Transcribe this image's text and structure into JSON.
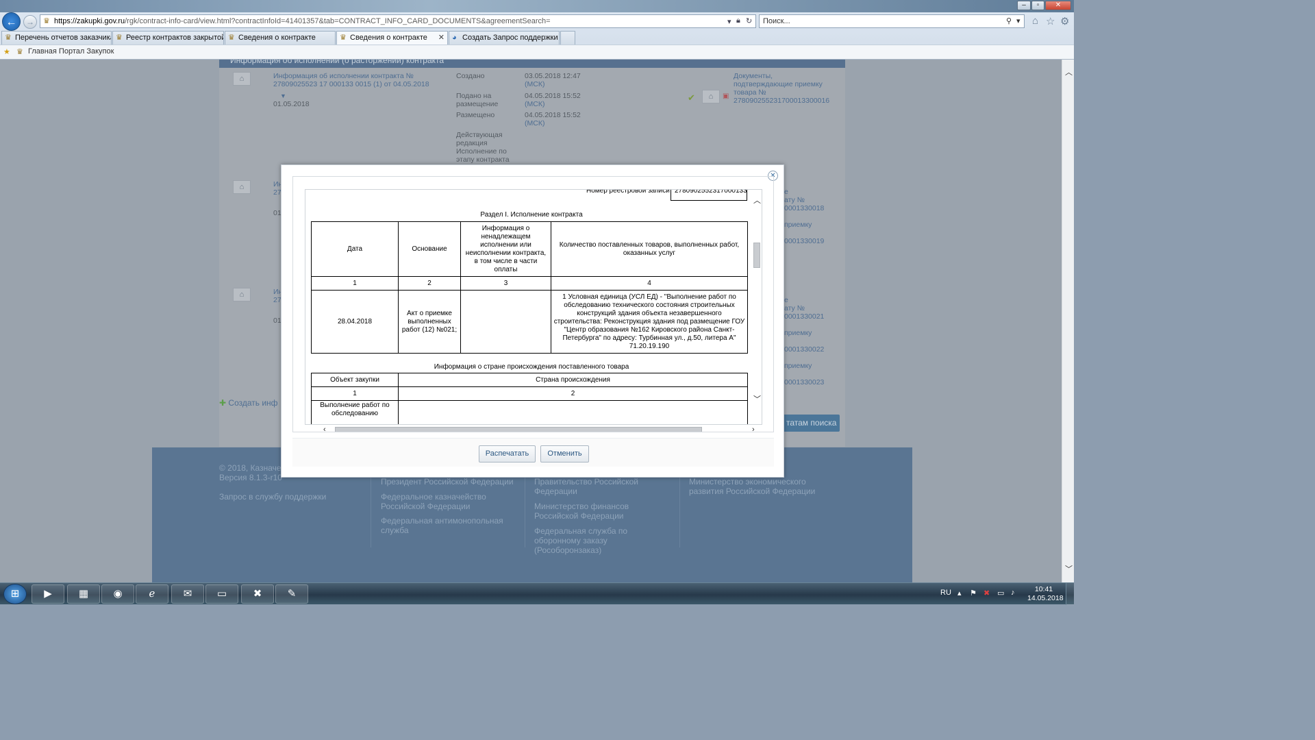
{
  "browser": {
    "url": "https://zakupki.gov.ru/rgk/contract-info-card/view.html?contractInfoId=41401357&tab=CONTRACT_INFO_CARD_DOCUMENTS&agreementSearch=",
    "url_host": "https://zakupki.gov.ru",
    "url_path": "/rgk/contract-info-card/view.html?contractInfoId=41401357&tab=CONTRACT_INFO_CARD_DOCUMENTS&agreementSearch=",
    "search_placeholder": "Поиск...",
    "tabs": [
      {
        "label": "Перечень отчетов заказчика"
      },
      {
        "label": "Реестр контрактов закрытой ..."
      },
      {
        "label": "Сведения о контракте"
      },
      {
        "label": "Сведения о контракте",
        "active": true
      },
      {
        "label": "Создать Запрос поддержки - ..."
      }
    ],
    "favorites": {
      "item": "Главная Портал Закупок"
    }
  },
  "page": {
    "panel_title": "Информация об исполнении (о расторжении) контракта",
    "row1": {
      "title": "Информация об исполнении контракта № 27809025523 17 000133 0015 (1) от 04.05.2018",
      "date": "01.05.2018",
      "created_label": "Создано",
      "created_date": "03.05.2018 12:47",
      "tz": "(МСК)",
      "submitted_label": "Подано на размещение",
      "submitted_date": "04.05.2018 15:52",
      "placed_label": "Размещено",
      "placed_date": "04.05.2018 15:52",
      "current_label": "Действующая редакция Исполнение по этапу контракта",
      "docs_link": "Документы, подтверждающие приемку товара № 278090255231700013300016"
    },
    "partial_left": [
      "Ин",
      "27",
      "01",
      "Ин",
      "27",
      "01"
    ],
    "partial_right": [
      "е",
      "ату №",
      "0001330018",
      "приемку",
      "0001330019",
      "е",
      "ату №",
      "0001330021",
      "приемку",
      "0001330022",
      "приемку",
      "0001330023"
    ],
    "create_link": "Создать инф",
    "results_button": "татам поиска",
    "footer": {
      "copyright": "© 2018, Казначе",
      "version": "Версия 8.1.3-r10",
      "support": "Запрос в службу поддержки",
      "col2": [
        "Президент Российской Федерации",
        "Федеральное казначейство Российской Федерации",
        "Федеральная антимонопольная служба"
      ],
      "col3": [
        "Правительство Российской Федерации",
        "Министерство финансов Российской Федерации",
        "Федеральная служба по оборонному заказу (Рособоронзаказ)"
      ],
      "col4": [
        "Министерство экономического развития Российской Федерации"
      ]
    }
  },
  "modal": {
    "reg_label": "Номер реестровой записи",
    "reg_value": "2780902552317000133",
    "section_title": "Раздел I. Исполнение контракта",
    "table1": {
      "headers": [
        "Дата",
        "Основание",
        "Информация о ненадлежащем исполнении или неисполнении контракта, в том числе в части оплаты",
        "Количество поставленных товаров, выполненных работ, оказанных услуг"
      ],
      "numbers": [
        "1",
        "2",
        "3",
        "4"
      ],
      "row": [
        "28.04.2018",
        "Акт о приемке выполненных работ (12) №021;",
        "",
        "1 Условная единица (УСЛ ЕД) - \"Выполнение работ по обследованию технического состояния строительных конструкций здания объекта незавершенного строительства: Реконструкция здания под размещение ГОУ \"Центр образования №162 Кировского района Санкт-Петербурга\" по адресу: Турбинная ул., д.50, литера А\" 71.20.19.190"
      ]
    },
    "origin_title": "Информация о стране происхождения поставленного товара",
    "table2": {
      "headers": [
        "Объект закупки",
        "Страна происхождения"
      ],
      "numbers": [
        "1",
        "2"
      ],
      "row_start": "Выполнение работ по обследованию"
    },
    "print_button": "Распечатать",
    "cancel_button": "Отменить"
  },
  "taskbar": {
    "lang": "RU",
    "time": "10:41",
    "date": "14.05.2018"
  },
  "colors": {
    "accent": "#3b6fa0",
    "panel_head": "#56708f",
    "footer": "#5a7592",
    "link": "#4f6e92"
  }
}
